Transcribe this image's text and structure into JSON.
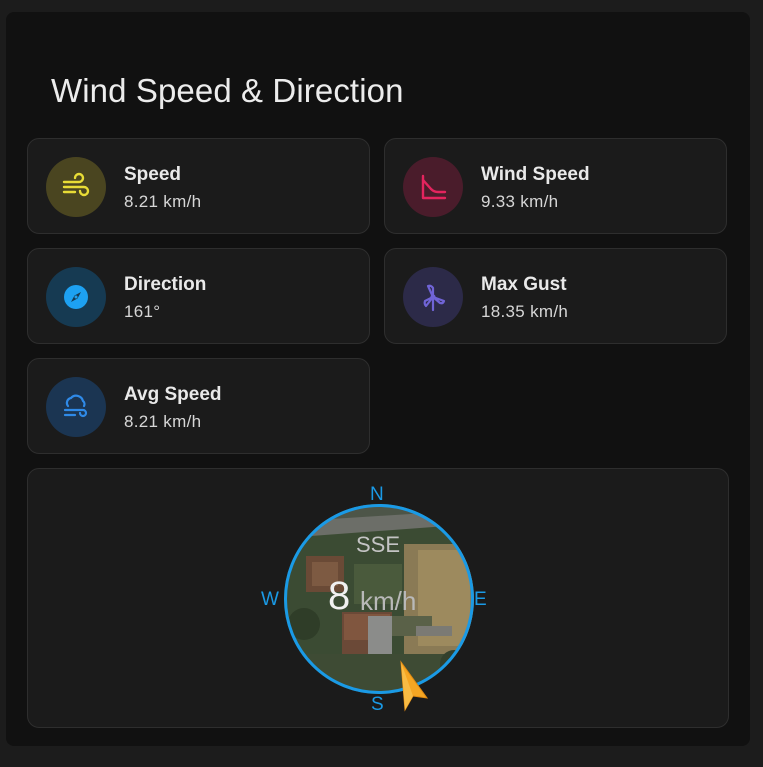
{
  "card": {
    "title": "Wind Speed & Direction"
  },
  "tiles": [
    {
      "label": "Speed",
      "value": "8.21 km/h",
      "icon": "wind-lines-icon",
      "color": "#e8dc36",
      "bg": "#4a4520"
    },
    {
      "label": "Wind Speed",
      "value": "9.33 km/h",
      "icon": "decay-chart-icon",
      "color": "#e3245e",
      "bg": "#4a1c2b"
    },
    {
      "label": "Direction",
      "value": "161°",
      "icon": "compass-icon",
      "color": "#1da1f2",
      "bg": "#163a52"
    },
    {
      "label": "Max Gust",
      "value": "18.35 km/h",
      "icon": "wind-turbine-icon",
      "color": "#7064d6",
      "bg": "#2c2a48"
    },
    {
      "label": "Avg Speed",
      "value": "8.21 km/h",
      "icon": "cloud-wind-icon",
      "color": "#2f8ae8",
      "bg": "#1b3552"
    }
  ],
  "compass": {
    "north": "N",
    "east": "E",
    "south": "S",
    "west": "W",
    "direction_label": "SSE",
    "speed": "8",
    "unit": "km/h",
    "ring_color": "#1a9ae6",
    "arrow_color": "#f5a623",
    "direction_degrees": 161
  }
}
